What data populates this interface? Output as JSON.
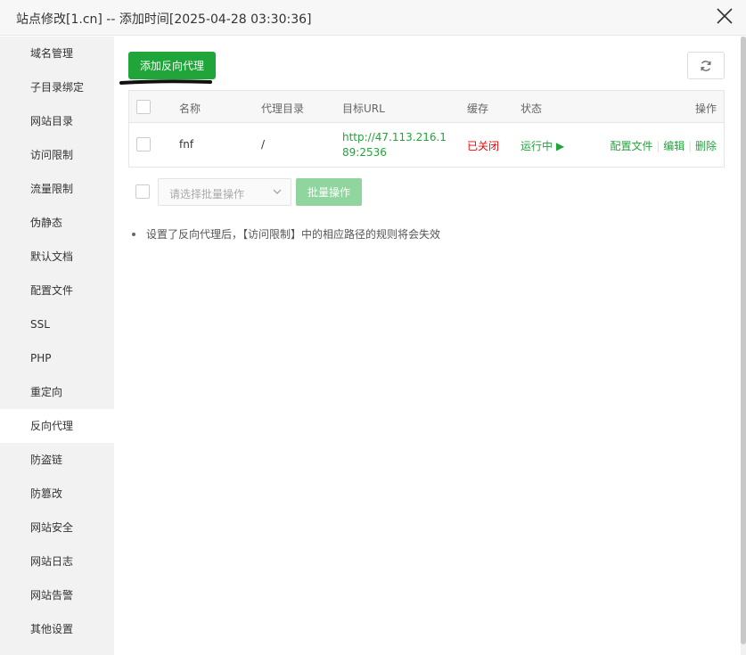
{
  "window": {
    "title": "站点修改[1.cn] -- 添加时间[2025-04-28 03:30:36]",
    "close_icon": "close-icon"
  },
  "sidebar": {
    "items": [
      {
        "label": "域名管理"
      },
      {
        "label": "子目录绑定"
      },
      {
        "label": "网站目录"
      },
      {
        "label": "访问限制"
      },
      {
        "label": "流量限制"
      },
      {
        "label": "伪静态"
      },
      {
        "label": "默认文档"
      },
      {
        "label": "配置文件"
      },
      {
        "label": "SSL"
      },
      {
        "label": "PHP"
      },
      {
        "label": "重定向"
      },
      {
        "label": "反向代理"
      },
      {
        "label": "防盗链"
      },
      {
        "label": "防篡改"
      },
      {
        "label": "网站安全"
      },
      {
        "label": "网站日志"
      },
      {
        "label": "网站告警"
      },
      {
        "label": "其他设置"
      }
    ],
    "active": "反向代理"
  },
  "toolbar": {
    "add_label": "添加反向代理",
    "refresh_icon": "refresh-icon"
  },
  "table": {
    "headers": {
      "name": "名称",
      "dir": "代理目录",
      "url": "目标URL",
      "cache": "缓存",
      "status": "状态",
      "ops": "操作"
    },
    "rows": [
      {
        "name": "fnf",
        "dir": "/",
        "url": "http://47.113.216.189:2536",
        "cache": "已关闭",
        "status": "运行中 ▶",
        "op_config": "配置文件",
        "op_edit": "编辑",
        "op_delete": "删除"
      }
    ],
    "separator": "|"
  },
  "batch": {
    "select_placeholder": "请选择批量操作",
    "button_label": "批量操作"
  },
  "tips": [
    "设置了反向代理后，【访问限制】中的相应路径的规则将会失效"
  ],
  "colors": {
    "accent": "#20a53a",
    "danger": "#ef0808",
    "sidebar_bg": "#f2f2f2"
  }
}
